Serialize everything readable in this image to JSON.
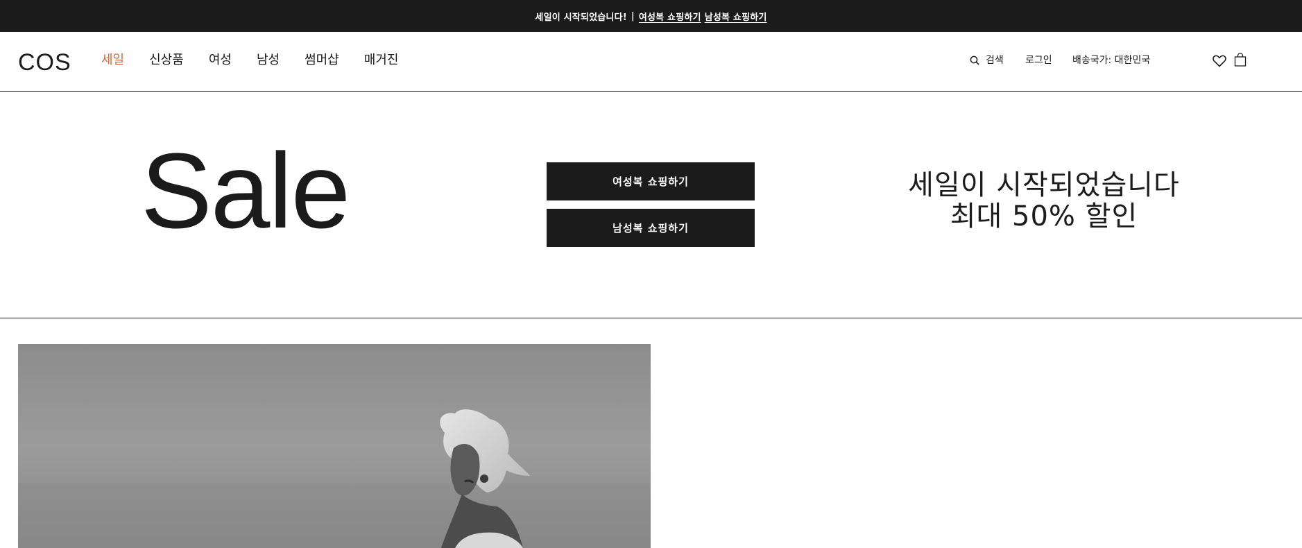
{
  "announcement": {
    "text": "세일이 시작되었습니다!",
    "separator": "|",
    "link_women": "여성복 쇼핑하기",
    "link_men": "남성복 쇼핑하기"
  },
  "header": {
    "logo": "COS",
    "nav": [
      {
        "label": "세일",
        "active": true
      },
      {
        "label": "신상품"
      },
      {
        "label": "여성"
      },
      {
        "label": "남성"
      },
      {
        "label": "썸머샵"
      },
      {
        "label": "매거진"
      }
    ],
    "search_label": "검색",
    "login_label": "로그인",
    "country_label": "배송국가: 대한민국",
    "icons": [
      "search-icon",
      "heart-icon",
      "shopping-bag-icon"
    ]
  },
  "hero": {
    "title": "Sale",
    "cta_women": "여성복 쇼핑하기",
    "cta_men": "남성복 쇼핑하기",
    "headline_line1": "세일이 시작되었습니다",
    "headline_line2": "최대 50% 할인"
  },
  "colors": {
    "bar_bg": "#1b1b1b",
    "accent_active_nav": "#d1683f",
    "text": "#1b1b1b",
    "button_bg": "#1b1b1b"
  }
}
